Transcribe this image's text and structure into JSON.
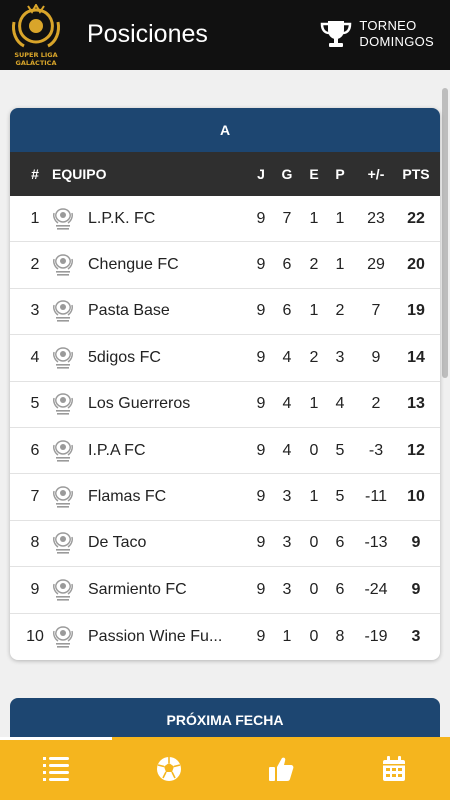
{
  "header": {
    "logo_text_top": "SUPER LIGA",
    "logo_text_bottom": "GALÁCTICA",
    "title": "Posiciones",
    "tournament_line1": "TORNEO",
    "tournament_line2": "DOMINGOS"
  },
  "standings": {
    "group": "A",
    "columns": {
      "pos": "#",
      "team": "EQUIPO",
      "played": "J",
      "won": "G",
      "drawn": "E",
      "lost": "P",
      "diff": "+/-",
      "points": "PTS"
    },
    "rows": [
      {
        "pos": "1",
        "team": "L.P.K. FC",
        "j": "9",
        "g": "7",
        "e": "1",
        "p": "1",
        "dif": "23",
        "pts": "22"
      },
      {
        "pos": "2",
        "team": "Chengue FC",
        "j": "9",
        "g": "6",
        "e": "2",
        "p": "1",
        "dif": "29",
        "pts": "20"
      },
      {
        "pos": "3",
        "team": "Pasta Base",
        "j": "9",
        "g": "6",
        "e": "1",
        "p": "2",
        "dif": "7",
        "pts": "19"
      },
      {
        "pos": "4",
        "team": "5digos FC",
        "j": "9",
        "g": "4",
        "e": "2",
        "p": "3",
        "dif": "9",
        "pts": "14"
      },
      {
        "pos": "5",
        "team": "Los Guerreros",
        "j": "9",
        "g": "4",
        "e": "1",
        "p": "4",
        "dif": "2",
        "pts": "13"
      },
      {
        "pos": "6",
        "team": "I.P.A FC",
        "j": "9",
        "g": "4",
        "e": "0",
        "p": "5",
        "dif": "-3",
        "pts": "12"
      },
      {
        "pos": "7",
        "team": "Flamas FC",
        "j": "9",
        "g": "3",
        "e": "1",
        "p": "5",
        "dif": "-11",
        "pts": "10"
      },
      {
        "pos": "8",
        "team": "De Taco",
        "j": "9",
        "g": "3",
        "e": "0",
        "p": "6",
        "dif": "-13",
        "pts": "9"
      },
      {
        "pos": "9",
        "team": "Sarmiento FC",
        "j": "9",
        "g": "3",
        "e": "0",
        "p": "6",
        "dif": "-24",
        "pts": "9"
      },
      {
        "pos": "10",
        "team": "Passion Wine Fu...",
        "j": "9",
        "g": "1",
        "e": "0",
        "p": "8",
        "dif": "-19",
        "pts": "3"
      }
    ]
  },
  "next_round": {
    "title": "PRÓXIMA FECHA"
  },
  "nav": {
    "items": [
      {
        "icon": "standings-list-icon",
        "active": true
      },
      {
        "icon": "soccer-ball-icon",
        "active": false
      },
      {
        "icon": "thumbs-up-icon",
        "active": false
      },
      {
        "icon": "calendar-icon",
        "active": false
      }
    ]
  },
  "colors": {
    "header_bg": "#111111",
    "group_header_bg": "#1d4671",
    "table_head_bg": "#2f2f2f",
    "nav_bg": "#f5b51e",
    "logo_gold": "#d9a52a"
  }
}
